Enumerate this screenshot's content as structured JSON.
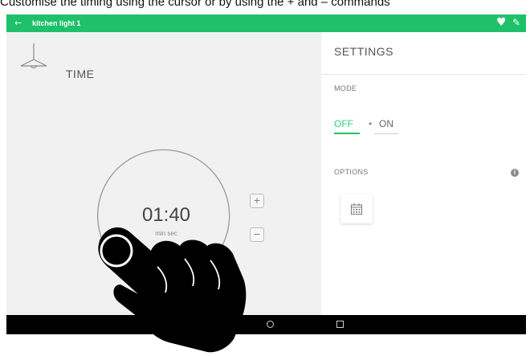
{
  "caption": "Customise the timing using the cursor or by using the + and – commands",
  "topbar": {
    "back_icon": "←",
    "device_name": "kitchen light 1",
    "favorite_icon": "♥",
    "edit_icon": "✎"
  },
  "timer": {
    "section_label": "TIME",
    "value": "01:40",
    "units": "min  sec",
    "plus_label": "+",
    "minus_label": "−"
  },
  "settings": {
    "title": "SETTINGS",
    "mode_label": "MODE",
    "mode_off": "OFF",
    "mode_separator": "•",
    "mode_on": "ON",
    "mode_selected": "OFF",
    "options_label": "OPTIONS",
    "info_icon": "i"
  },
  "colors": {
    "accent": "#1ec16a",
    "panel": "#f1f1f1",
    "navbar": "#000000"
  },
  "icons": {
    "lamp": "ceiling-lamp-icon",
    "calendar": "calendar-icon",
    "hand": "pointing-hand-icon"
  }
}
